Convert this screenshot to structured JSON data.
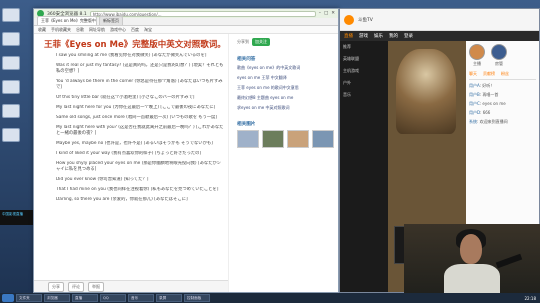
{
  "browser": {
    "title": "360安全浏览器 8.1",
    "url": "http://www.ibaidu.com/question/...",
    "tabs": [
      {
        "label": "王菲《Eyes on Me》完整版中英文..."
      },
      {
        "label": "新标签页"
      }
    ],
    "bookmarks": [
      "收藏",
      "手机收藏夹",
      "谷歌",
      "网址导航",
      "游戏中心",
      "百度",
      "淘宝"
    ]
  },
  "song": {
    "title": "王菲《Eyes on Me》完整版中英文对照歌词。",
    "lyrics": [
      "I saw you smiling at me (我看见你在对我微笑) [あなたが微笑んでいるのを]",
      "Was it real or just my fantasy? (这是真的吗，还是只是我的幻想？) [現実？それとも私の空想？]",
      "You 'd always be there in the corner (你总是待在那个角落) [あなたはいつも片すみで]",
      "Of this tiny little bar (就在这个小酒吧里) [小さなこのバーの片すみで]",
      "My last night here for you (为你在这最后一个晚上) [ここで最後の夜にあなたに]",
      "Same old songs, just once more (唱同一首歌最后一次) [いつもの歌を もう一度]",
      "My last night here with you? (这是否在我就此离开之前最后一晚吗？) [これがあなたと一緒の最後の夜？]",
      "Maybe yes, maybe no (也许是，也许不是) [あるいはそうかも そうでないかも]",
      "I kind of liked it your way (我有点喜欢你的样子) [ちょっと好きだったの]",
      "How you shyly placed your eyes on me (那是你腼腆地将眼光投向我) [あなたがシャイに私を見つめる]",
      "Did you ever know (你可曾知道) [知ってた？]",
      "That I had mine on you (我也同样在注视着你) [私もあなたを見つめていたことを]",
      "Darling, so there you are (亲爱的，你就在那儿) [あなたはそこに]"
    ],
    "footer": {
      "share": "分享",
      "comment": "评论",
      "feedback": "举报"
    }
  },
  "sidebar": {
    "share_label": "分享到",
    "share_button": "加关注",
    "related_heading": "相关问答",
    "related": [
      {
        "title": "歌曲《eyes on me》的中英文歌词"
      },
      {
        "title": "eyes on me 王菲 中文翻译"
      },
      {
        "title": "王菲 eyes on me 的歌词中文意思"
      },
      {
        "title": "最终幻想8 主题曲 eyes on me"
      },
      {
        "title": "求eyes on me 中英对照歌词"
      }
    ],
    "pics_heading": "相关图片"
  },
  "stream": {
    "logo_text": "斗鱼TV",
    "nav": [
      "直播",
      "游戏",
      "娱乐",
      "我的",
      "登录"
    ],
    "side_menu": [
      "推荐",
      "英雄联盟",
      "主机游戏",
      "户外",
      "音乐"
    ],
    "anchors": [
      {
        "name": "主播"
      },
      {
        "name": "房管"
      }
    ],
    "chat_tabs": [
      "聊天",
      "贡献榜",
      "粉丝"
    ],
    "chat": [
      {
        "user": "用户A",
        "text": "好听！"
      },
      {
        "user": "用户B",
        "text": "再唱一首"
      },
      {
        "user": "用户C",
        "text": "eyes on me"
      },
      {
        "user": "用户D",
        "text": "666"
      },
      {
        "user": "系统",
        "text": "欢迎来到直播间"
      }
    ]
  },
  "taskbar": {
    "items": [
      "文件夹",
      "浏览器",
      "直播",
      "QQ",
      "音乐",
      "录屏",
      "控制面板"
    ],
    "time": "22:18"
  },
  "leftblock": "中国影视直播"
}
